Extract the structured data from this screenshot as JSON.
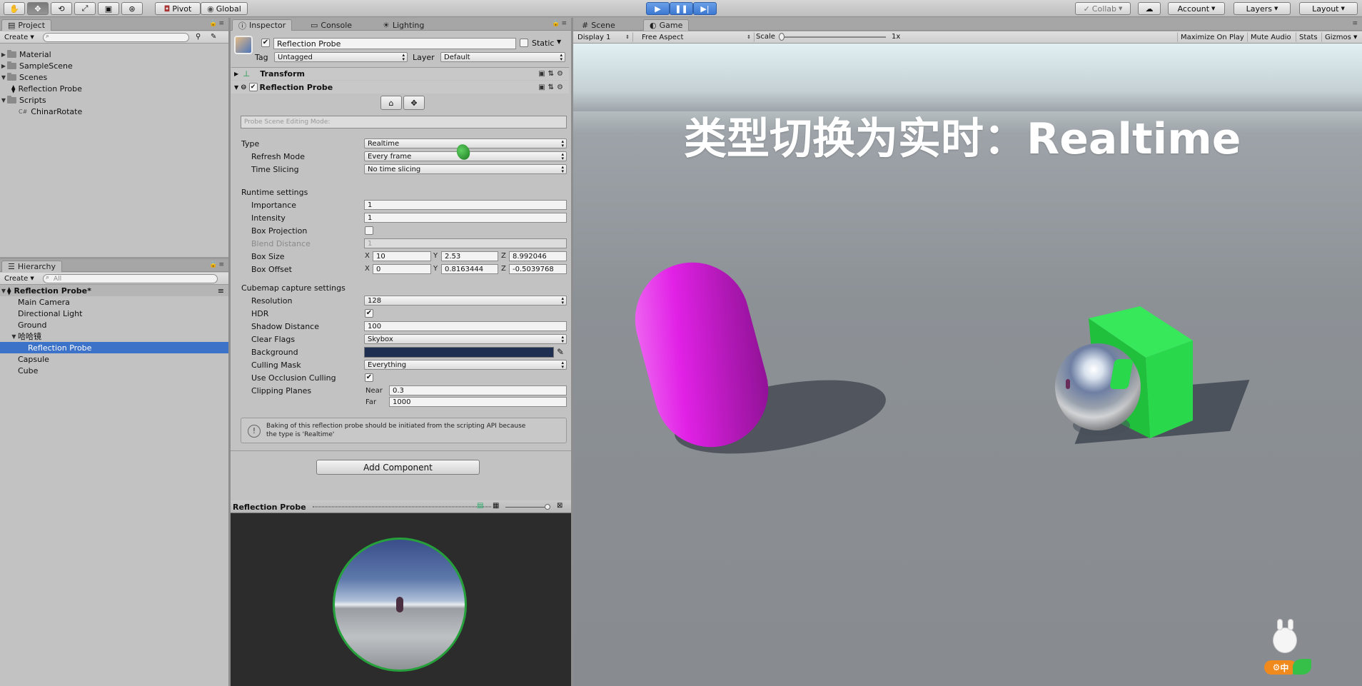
{
  "toolbar": {
    "pivot": "Pivot",
    "global": "Global",
    "collab": "Collab",
    "account": "Account",
    "layers": "Layers",
    "layout": "Layout"
  },
  "project": {
    "tab": "Project",
    "create": "Create",
    "items": [
      {
        "label": "Material",
        "icon": "folder-icon",
        "level": 0
      },
      {
        "label": "SampleScene",
        "icon": "unity-scene-icon",
        "level": 0
      },
      {
        "label": "Scenes",
        "icon": "folder-icon",
        "level": 0
      },
      {
        "label": "Reflection Probe",
        "icon": "unity-scene-icon",
        "level": 1
      },
      {
        "label": "Scripts",
        "icon": "folder-icon",
        "level": 0
      },
      {
        "label": "ChinarRotate",
        "icon": "script-icon",
        "level": 1
      }
    ]
  },
  "hierarchy": {
    "tab": "Hierarchy",
    "create": "Create",
    "search_placeholder": "All",
    "scene": "Reflection Probe*",
    "items": [
      {
        "label": "Main Camera",
        "level": 1
      },
      {
        "label": "Directional Light",
        "level": 1
      },
      {
        "label": "Ground",
        "level": 1
      },
      {
        "label": "哈哈镜",
        "level": 1
      },
      {
        "label": "Reflection Probe",
        "level": 2
      },
      {
        "label": "Capsule",
        "level": 1
      },
      {
        "label": "Cube",
        "level": 1
      }
    ]
  },
  "inspector": {
    "tabs": {
      "inspector": "Inspector",
      "console": "Console",
      "lighting": "Lighting"
    },
    "object_name": "Reflection Probe",
    "static_label": "Static",
    "tag_label": "Tag",
    "tag_value": "Untagged",
    "layer_label": "Layer",
    "layer_value": "Default",
    "transform": "Transform",
    "component": "Reflection Probe",
    "editing_mode": "Probe Scene Editing Mode:",
    "type_label": "Type",
    "type_value": "Realtime",
    "refresh_label": "Refresh Mode",
    "refresh_value": "Every frame",
    "slicing_label": "Time Slicing",
    "slicing_value": "No time slicing",
    "runtime_title": "Runtime settings",
    "importance_label": "Importance",
    "importance_value": "1",
    "intensity_label": "Intensity",
    "intensity_value": "1",
    "boxproj_label": "Box Projection",
    "blend_label": "Blend Distance",
    "blend_value": "1",
    "boxsize_label": "Box Size",
    "boxsize": {
      "x": "10",
      "y": "2.53",
      "z": "8.992046"
    },
    "boxoffset_label": "Box Offset",
    "boxoffset": {
      "x": "0",
      "y": "0.8163444",
      "z": "-0.5039768"
    },
    "axis": {
      "x": "X",
      "y": "Y",
      "z": "Z"
    },
    "cubemap_title": "Cubemap capture settings",
    "resolution_label": "Resolution",
    "resolution_value": "128",
    "hdr_label": "HDR",
    "shadow_label": "Shadow Distance",
    "shadow_value": "100",
    "clear_label": "Clear Flags",
    "clear_value": "Skybox",
    "background_label": "Background",
    "background_color": "#1e2f52",
    "culling_label": "Culling Mask",
    "culling_value": "Everything",
    "occlusion_label": "Use Occlusion Culling",
    "clipping_label": "Clipping Planes",
    "near_label": "Near",
    "near_value": "0.3",
    "far_label": "Far",
    "far_value": "1000",
    "info_line1": "Baking of this reflection probe should be initiated from the scripting API because",
    "info_line2": "the type is 'Realtime'",
    "add_component": "Add Component",
    "preview_title": "Reflection Probe"
  },
  "game": {
    "tab_scene": "Scene",
    "tab_game": "Game",
    "display": "Display 1",
    "aspect": "Free Aspect",
    "scale_label": "Scale",
    "scale_value": "1x",
    "maximize": "Maximize On Play",
    "mute": "Mute Audio",
    "stats": "Stats",
    "gizmos": "Gizmos",
    "overlay_text": "类型切换为实时：Realtime",
    "ime_text": "中"
  },
  "colors": {
    "accent": "#3d72c9",
    "capsule": "#e020e6",
    "cube": "#2ad84c"
  }
}
